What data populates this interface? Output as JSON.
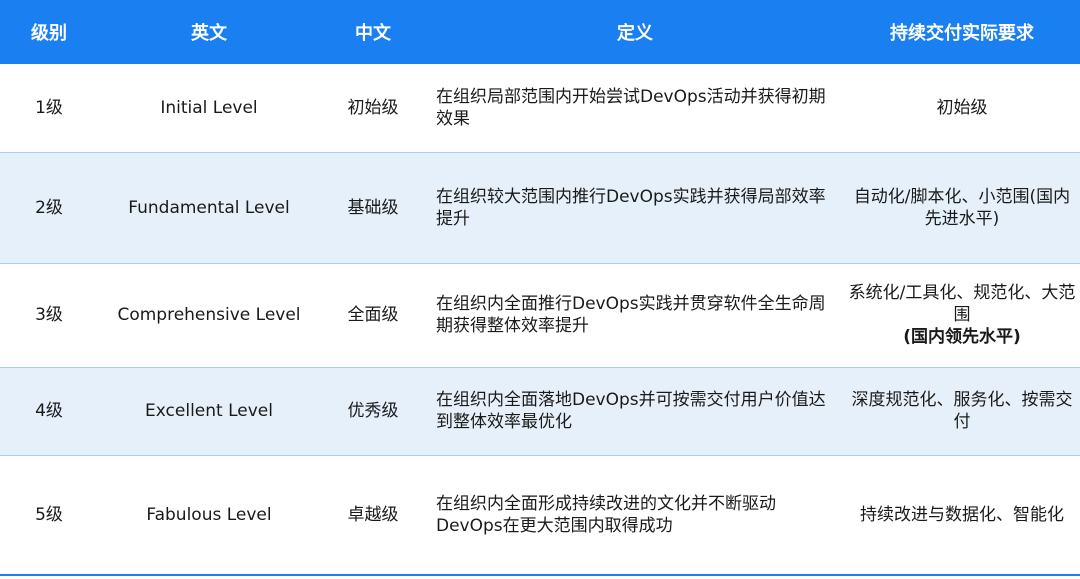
{
  "headers": [
    "级别",
    "英文",
    "中文",
    "定义",
    "持续交付实际要求"
  ],
  "rows": [
    {
      "level": "1级",
      "english": "Initial Level",
      "chinese": "初始级",
      "definition": "在组织局部范围内开始尝试DevOps活动并获得初期效果",
      "requirement": "初始级",
      "requirement_emphasis": ""
    },
    {
      "level": "2级",
      "english": "Fundamental Level",
      "chinese": "基础级",
      "definition": "在组织较大范围内推行DevOps实践并获得局部效率提升",
      "requirement": "自动化/脚本化、小范围(国内先进水平)",
      "requirement_emphasis": ""
    },
    {
      "level": "3级",
      "english": "Comprehensive Level",
      "chinese": "全面级",
      "definition": "在组织内全面推行DevOps实践并贯穿软件全生命周期获得整体效率提升",
      "requirement": "系统化/工具化、规范化、大范围",
      "requirement_emphasis": "(国内领先水平)"
    },
    {
      "level": "4级",
      "english": "Excellent Level",
      "chinese": "优秀级",
      "definition": "在组织内全面落地DevOps并可按需交付用户价值达到整体效率最优化",
      "requirement": "深度规范化、服务化、按需交付",
      "requirement_emphasis": ""
    },
    {
      "level": "5级",
      "english": "Fabulous Level",
      "chinese": "卓越级",
      "definition": "在组织内全面形成持续改进的文化并不断驱动DevOps在更大范围内取得成功",
      "requirement": "持续改进与数据化、智能化",
      "requirement_emphasis": ""
    }
  ]
}
